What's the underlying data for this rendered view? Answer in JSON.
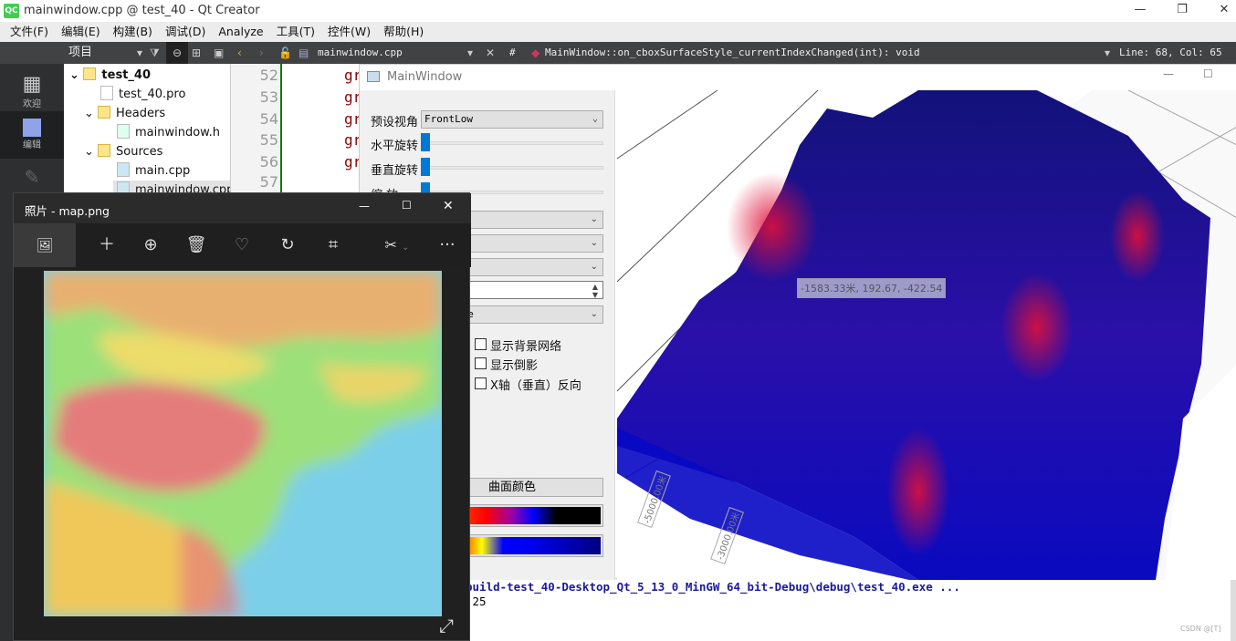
{
  "app": {
    "title": "mainwindow.cpp @ test_40 - Qt Creator",
    "logo": "QC",
    "window_controls": [
      "minimize",
      "maximize",
      "close"
    ]
  },
  "menu": [
    "文件(F)",
    "编辑(E)",
    "构建(B)",
    "调试(D)",
    "Analyze",
    "工具(T)",
    "控件(W)",
    "帮助(H)"
  ],
  "toolbar": {
    "project_label": "项目",
    "file": "mainwindow.cpp",
    "hash": "#",
    "symbol": "MainWindow::on_cboxSurfaceStyle_currentIndexChanged(int): void",
    "position": "Line: 68, Col: 65"
  },
  "modes": [
    {
      "label": "欢迎",
      "icon": "grid-icon"
    },
    {
      "label": "编辑",
      "icon": "edit-doc-icon"
    },
    {
      "label": "设计",
      "icon": "pencil-icon"
    }
  ],
  "tree": [
    {
      "label": "test_40",
      "level": 0,
      "bold": true,
      "expanded": true
    },
    {
      "label": "test_40.pro",
      "level": 1
    },
    {
      "label": "Headers",
      "level": 1,
      "expanded": true
    },
    {
      "label": "mainwindow.h",
      "level": 2
    },
    {
      "label": "Sources",
      "level": 1,
      "expanded": true
    },
    {
      "label": "main.cpp",
      "level": 2
    },
    {
      "label": "mainwindow.cpp",
      "level": 2,
      "selected": true
    }
  ],
  "gutter": [
    "52",
    "53",
    "54",
    "55",
    "56",
    "57"
  ],
  "code": [
    "gr",
    "gr",
    "gr",
    "gr",
    "gr"
  ],
  "mainwindow": {
    "title": "MainWindow",
    "preset_label": "预设视角",
    "preset_value": "FrontLow",
    "hrot_label": "水平旋转",
    "vrot_label": "垂直旋转",
    "zoom_label": "缩    放",
    "spin_value": "",
    "combo5_value": "e",
    "checkboxes": [
      "显示背景网络",
      "显示倒影",
      "X轴（垂直）反向"
    ],
    "surface_color_button": "曲面颜色",
    "tooltip": "-1583.33米, 192.67, -422.54",
    "axis_labels": [
      "-5000.00米",
      "-3000.00米"
    ],
    "colors": {
      "surface_low": "#0a0ac8",
      "surface_high": "#e0103a"
    }
  },
  "photos": {
    "title": "照片 - map.png",
    "tools": [
      "image-icon",
      "plus-icon",
      "zoom-in-icon",
      "delete-icon",
      "heart-icon",
      "rotate-icon",
      "crop-icon",
      "edit-icon",
      "more-icon"
    ],
    "more": "···",
    "expand": "⤢"
  },
  "output": {
    "line1": "build-test_40-Desktop_Qt_5_13_0_MinGW_64_bit-Debug\\debug\\test_40.exe ...",
    "line2": ".25",
    "watermark": "CSDN @[T]"
  }
}
